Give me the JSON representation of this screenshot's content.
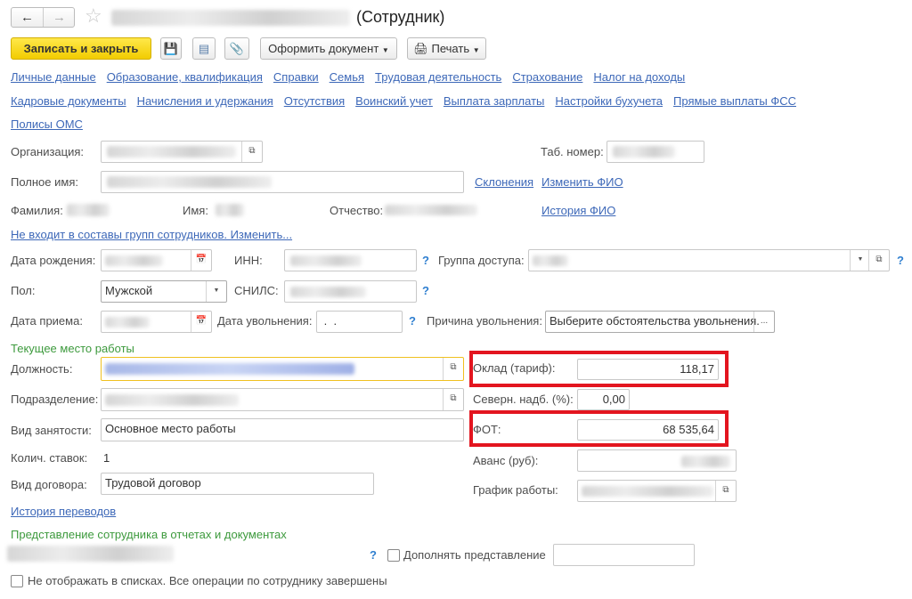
{
  "header": {
    "title_suffix": "(Сотрудник)"
  },
  "toolbar": {
    "save_close": "Записать и закрыть",
    "make_document": "Оформить документ",
    "print": "Печать"
  },
  "links_row1": [
    "Личные данные",
    "Образование, квалификация",
    "Справки",
    "Семья",
    "Трудовая деятельность",
    "Страхование",
    "Налог на доходы"
  ],
  "links_row2": [
    "Кадровые документы",
    "Начисления и удержания",
    "Отсутствия",
    "Воинский учет",
    "Выплата зарплаты",
    "Настройки бухучета",
    "Прямые выплаты ФСС"
  ],
  "links_row3": [
    "Полисы ОМС"
  ],
  "form": {
    "org_label": "Организация:",
    "tab_label": "Таб. номер:",
    "fullname_label": "Полное имя:",
    "declensions": "Склонения",
    "change_fio": "Изменить ФИО",
    "surname_label": "Фамилия:",
    "name_label": "Имя:",
    "patronymic_label": "Отчество:",
    "fio_history": "История ФИО",
    "groups_link": "Не входит в составы групп сотрудников. Изменить...",
    "birth_label": "Дата рождения:",
    "inn_label": "ИНН:",
    "access_label": "Группа доступа:",
    "sex_label": "Пол:",
    "sex_value": "Мужской",
    "snils_label": "СНИЛС:",
    "hire_label": "Дата приема:",
    "fire_label": "Дата увольнения:",
    "fire_value": " .  .",
    "fire_reason_label": "Причина увольнения:",
    "fire_reason_value": "Выберите обстоятельства увольнения.",
    "ellipsis": "...",
    "help": "?"
  },
  "work": {
    "section": "Текущее место работы",
    "position_label": "Должность:",
    "dept_label": "Подразделение:",
    "employment_label": "Вид занятости:",
    "employment_value": "Основное место работы",
    "rates_label": "Колич. ставок:",
    "rates_value": "1",
    "contract_label": "Вид договора:",
    "contract_value": "Трудовой договор",
    "salary_label": "Оклад (тариф):",
    "salary_value": "118,17",
    "north_label": "Северн. надб. (%):",
    "north_value": "0,00",
    "fot_label": "ФОТ:",
    "fot_value": "68 535,64",
    "advance_label": "Аванс (руб):",
    "schedule_label": "График работы:",
    "transfers_link": "История переводов"
  },
  "repr": {
    "section": "Представление сотрудника в отчетах и документах",
    "supplement_label": "Дополнять представление",
    "hide_label": "Не отображать в списках. Все операции по сотруднику завершены"
  }
}
